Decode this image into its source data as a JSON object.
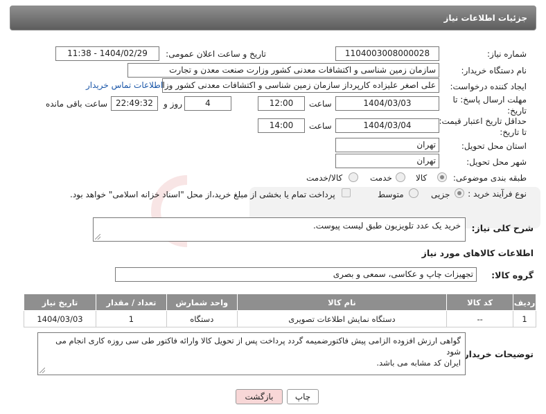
{
  "header": {
    "title": "جزئیات اطلاعات نیاز"
  },
  "fields": {
    "need_number_label": "شماره نیاز:",
    "need_number": "1104003008000028",
    "announce_label": "تاریخ و ساعت اعلان عمومی:",
    "announce_value": "1404/02/29 - 11:38",
    "buyer_label": "نام دستگاه خریدار:",
    "buyer_value": "سازمان زمین شناسی و اکتشافات معدنی کشور وزارت صنعت معدن و تجارت",
    "creator_label": "ایجاد کننده درخواست:",
    "creator_value": "علی اصغر علیزاده کارپرداز سازمان زمین شناسی و اکتشافات معدنی کشور وزارت صنعت معدن و تجارت",
    "contact_link": "اطلاعات تماس خریدار",
    "deadline_label_1": "مهلت ارسال پاسخ: تا",
    "deadline_label_2": "تاریخ:",
    "deadline_date": "1404/03/03",
    "time_label": "ساعت",
    "deadline_time": "12:00",
    "days_value": "4",
    "days_label": "روز و",
    "remaining_value": "22:49:32",
    "remaining_label": "ساعت باقی مانده",
    "validity_label_1": "حداقل تاریخ اعتبار قیمت:",
    "validity_label_2": "تا تاریخ:",
    "validity_date": "1404/03/04",
    "validity_time": "14:00",
    "province_label": "استان محل تحویل:",
    "province_value": "تهران",
    "city_label": "شهر محل تحویل:",
    "city_value": "تهران",
    "category_label": "طبقه بندی موضوعی:",
    "cat_goods": "کالا",
    "cat_service": "خدمت",
    "cat_both": "کالا/خدمت",
    "purchase_label": "نوع فرآیند خرید :",
    "pt_partial": "جزیی",
    "pt_medium": "متوسط",
    "payment_note": "پرداخت تمام یا بخشی از مبلغ خرید،از محل \"اسناد خزانه اسلامی\" خواهد بود."
  },
  "description": {
    "label": "شرح کلی نیاز:",
    "text": "خرید یک عدد تلویزیون طبق لیست پیوست."
  },
  "items_section": {
    "title": "اطلاعات کالاهای مورد نیاز",
    "group_label": "گروه کالا:",
    "group_value": "تجهیزات چاپ و عکاسی، سمعی و بصری"
  },
  "table": {
    "headers": [
      "ردیف",
      "کد کالا",
      "نام کالا",
      "واحد شمارش",
      "تعداد / مقدار",
      "تاریخ نیاز"
    ],
    "rows": [
      [
        "1",
        "--",
        "دستگاه نمایش اطلاعات تصویری",
        "دستگاه",
        "1",
        "1404/03/03"
      ]
    ]
  },
  "buyer_notes": {
    "label": "توضیحات خریدار:",
    "line1": "گواهی ارزش افزوده الزامی پیش فاکتورضمیمه گردد پرداخت پس از تحویل کالا وارائه فاکتور طی سی روزه کاری انجام می",
    "line2": "شود",
    "line3": "ایران کد مشابه می باشد."
  },
  "buttons": {
    "print": "چاپ",
    "back": "بازگشت"
  },
  "colors": {
    "header_bg": "#6f6f6f",
    "table_header_bg": "#8f8f8f",
    "link": "#1a56a8",
    "back_btn_bg": "#f8d7d7"
  }
}
